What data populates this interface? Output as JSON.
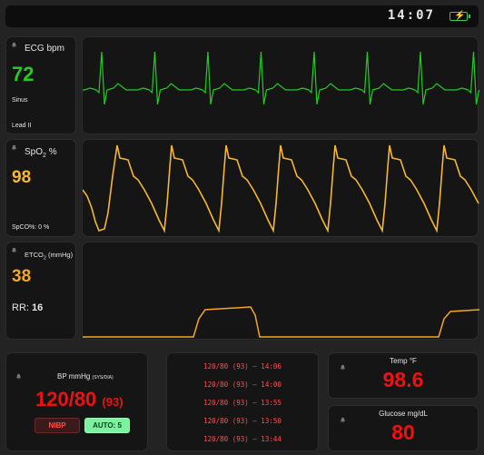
{
  "status_bar": {
    "time": "14:07",
    "battery_icon": "battery-charging-icon"
  },
  "ecg": {
    "label": "ECG bpm",
    "value": "72",
    "rhythm": "Sinus",
    "lead": "Lead II",
    "color": "#22cc22"
  },
  "spo2": {
    "label_main": "SpO",
    "label_sub": "2",
    "label_unit": " %",
    "value": "98",
    "spco": "SpCO%: 0 %",
    "color": "#f5b731"
  },
  "etco2": {
    "label_main": "ETCO",
    "label_sub": "2",
    "label_unit": " (mmHg)",
    "value": "38",
    "rr_label": "RR:",
    "rr_value": "16",
    "color": "#f5a623"
  },
  "bp": {
    "label": "BP mmHg",
    "label_sub": "(SYS/DIA)",
    "value": "120/80",
    "mean": "(93)",
    "nibp_button": "NIBP",
    "auto_button": "AUTO: 5",
    "color": "#ee1111"
  },
  "history": [
    "120/80 (93) — 14:06",
    "120/80 (93) — 14:00",
    "120/80 (93) — 13:55",
    "120/80 (93) — 13:50",
    "120/80 (93) — 13:44"
  ],
  "temp": {
    "label": "Temp °F",
    "value": "98.6",
    "color": "#ee1111"
  },
  "glucose": {
    "label": "Glucose mg/dL",
    "value": "80",
    "color": "#ee1111"
  },
  "alarm_icon": "bell-icon"
}
